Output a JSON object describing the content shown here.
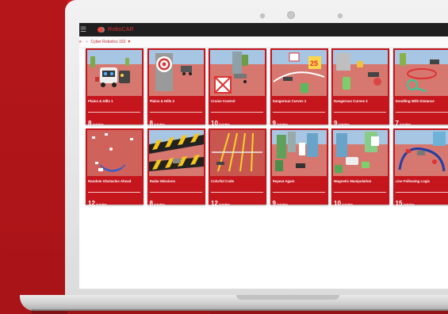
{
  "app": {
    "brand": "RoboCAR",
    "icons": {
      "menu": "hamburger-icon",
      "logo": "robocar-logo-icon",
      "breadcrumb_sep": "chevron-right-icon",
      "dropdown": "caret-down-icon"
    }
  },
  "breadcrumb": {
    "home": "e",
    "course": "Cyber Robotics 102"
  },
  "colors": {
    "accent": "#c5161d",
    "background": "#d0191d",
    "topbar": "#1f1f1f"
  },
  "cards": [
    {
      "title": "Plains & Hills 1",
      "count": "8",
      "unit": "Activities",
      "scene": "robot"
    },
    {
      "title": "Plains & Hills 2",
      "count": "8",
      "unit": "Activities",
      "scene": "target"
    },
    {
      "title": "Cruise Control",
      "count": "10",
      "unit": "Activities",
      "scene": "box"
    },
    {
      "title": "Dangerous Curves 1",
      "count": "9",
      "unit": "Activities",
      "scene": "curves"
    },
    {
      "title": "Dangerous Curves 2",
      "count": "9",
      "unit": "Activities",
      "scene": "curves2"
    },
    {
      "title": "Doodling With Distance",
      "count": "7",
      "unit": "Activities",
      "scene": "doodle"
    },
    {
      "title": "Random Obstacles Ahead",
      "count": "12",
      "unit": "Activities",
      "scene": "radar"
    },
    {
      "title": "Radar Missions",
      "count": "8",
      "unit": "Activities",
      "scene": "stripes"
    },
    {
      "title": "Colorful Code",
      "count": "12",
      "unit": "Activities",
      "scene": "lanes"
    },
    {
      "title": "Repeat Again",
      "count": "9",
      "unit": "Activities",
      "scene": "city"
    },
    {
      "title": "Magnetic Manipulation",
      "count": "10",
      "unit": "Activities",
      "scene": "magnet"
    },
    {
      "title": "Line Following Logic",
      "count": "15",
      "unit": "Activities",
      "scene": "line"
    }
  ]
}
